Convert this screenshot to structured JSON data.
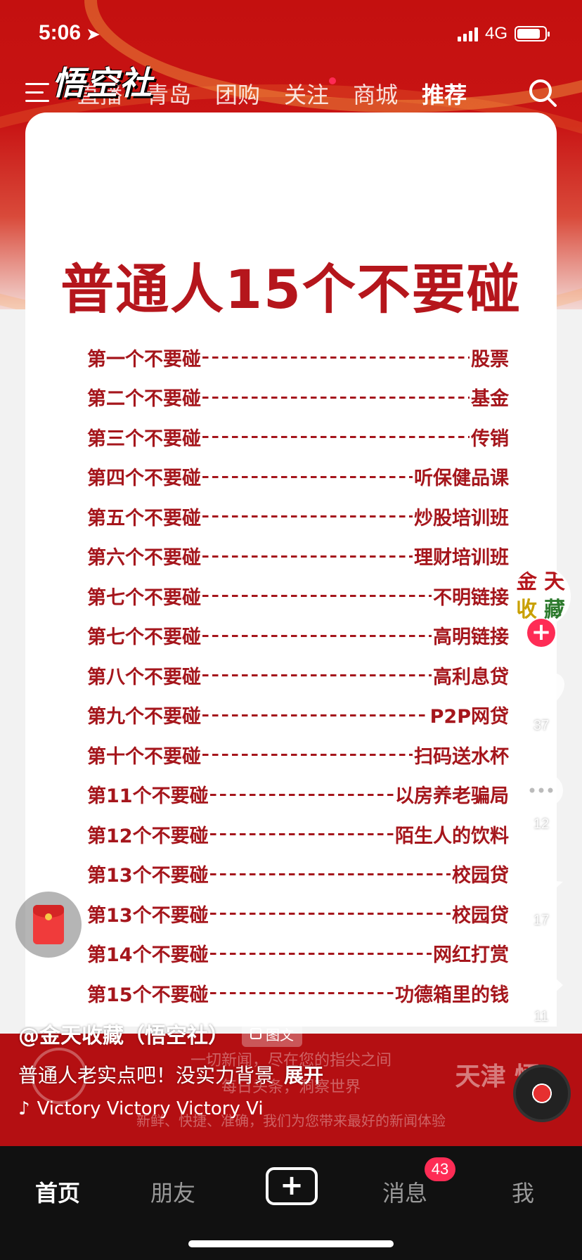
{
  "status_bar": {
    "time": "5:06",
    "network": "4G"
  },
  "watermark": "悟空社",
  "top_nav": {
    "tabs": [
      {
        "label": "直播"
      },
      {
        "label": "青岛"
      },
      {
        "label": "团购"
      },
      {
        "label": "关注"
      },
      {
        "label": "商城"
      },
      {
        "label": "推荐"
      }
    ],
    "active": "推荐"
  },
  "card": {
    "title": "普通人15个不要碰",
    "rules": [
      {
        "lead": "第一个不要碰",
        "item": "股票"
      },
      {
        "lead": "第二个不要碰",
        "item": "基金"
      },
      {
        "lead": "第三个不要碰",
        "item": "传销"
      },
      {
        "lead": "第四个不要碰",
        "item": "听保健品课"
      },
      {
        "lead": "第五个不要碰",
        "item": "炒股培训班"
      },
      {
        "lead": "第六个不要碰",
        "item": "理财培训班"
      },
      {
        "lead": "第七个不要碰",
        "item": "不明链接"
      },
      {
        "lead": "第七个不要碰",
        "item": "高明链接"
      },
      {
        "lead": "第八个不要碰",
        "item": "高利息贷"
      },
      {
        "lead": "第九个不要碰",
        "item": "P2P网贷"
      },
      {
        "lead": "第十个不要碰",
        "item": "扫码送水杯"
      },
      {
        "lead": "第11个不要碰",
        "item": "以房养老骗局"
      },
      {
        "lead": "第12个不要碰",
        "item": "陌生人的饮料"
      },
      {
        "lead": "第13个不要碰",
        "item": "校园贷"
      },
      {
        "lead": "第13个不要碰",
        "item": "校园贷"
      },
      {
        "lead": "第14个不要碰",
        "item": "网红打赏"
      },
      {
        "lead": "第15个不要碰",
        "item": "功德箱里的钱"
      }
    ]
  },
  "avatar": {
    "chars": [
      "金",
      "天",
      "收",
      "藏"
    ]
  },
  "actions": {
    "like_count": "37",
    "comment_count": "12",
    "favorite_count": "17",
    "share_count": "11"
  },
  "background_news": {
    "line1": "一切新闻，尽在您的指尖之间",
    "line2": "每日头条，洞察世界",
    "line3": "新鲜、快捷、准确，我们为您带来最好的新闻体验",
    "brand_right": "天津 悟"
  },
  "post": {
    "author": "@金天收藏（悟空社）",
    "type_badge": "图文",
    "caption": "普通人老实点吧！没实力背景",
    "expand": "展开",
    "music": "Victory   Victory   Victory   Vi"
  },
  "tab_bar": {
    "home": "首页",
    "friends": "朋友",
    "create": "+",
    "messages": "消息",
    "messages_badge": "43",
    "me": "我"
  },
  "colors": {
    "brand_red": "#b5161c",
    "accent_pink": "#fe2c55",
    "tab_bar_bg": "#111111"
  }
}
